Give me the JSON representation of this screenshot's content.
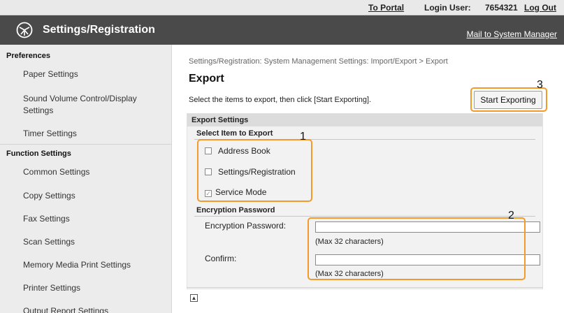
{
  "topbar": {
    "portal_link": "To Portal",
    "login_label": "Login User:",
    "login_user": "7654321",
    "logout_link": "Log Out"
  },
  "header": {
    "title": "Settings/Registration",
    "icon": "settings-registration-icon",
    "mail_link": "Mail to System Manager"
  },
  "sidebar": {
    "preferences_heading": "Preferences",
    "preferences_items": [
      "Paper Settings",
      "Sound Volume Control/Display Settings",
      "Timer Settings"
    ],
    "function_heading": "Function Settings",
    "function_items": [
      "Common Settings",
      "Copy Settings",
      "Fax Settings",
      "Scan Settings",
      "Memory Media Print Settings",
      "Printer Settings",
      "Output Report Settings"
    ]
  },
  "main": {
    "breadcrumb": "Settings/Registration: System Management Settings: Import/Export > Export",
    "title": "Export",
    "instruction": "Select the items to export, then click [Start Exporting].",
    "start_button": "Start Exporting",
    "export_settings_heading": "Export Settings",
    "select_heading": "Select Item to Export",
    "items": [
      {
        "label": "Address Book",
        "checked": false
      },
      {
        "label": "Settings/Registration",
        "checked": false
      },
      {
        "label": "Service Mode",
        "checked": true
      }
    ],
    "encryption_heading": "Encryption Password",
    "password_label": "Encryption Password:",
    "password_value": "",
    "password_hint": "(Max 32 characters)",
    "confirm_label": "Confirm:",
    "confirm_value": "",
    "confirm_hint": "(Max 32 characters)",
    "top_icon": "scroll-to-top-icon"
  },
  "callouts": [
    "1",
    "2",
    "3"
  ],
  "colors": {
    "header_bg": "#4a4a4a",
    "sidebar_bg": "#ececec",
    "callout": "#f39a2b"
  }
}
